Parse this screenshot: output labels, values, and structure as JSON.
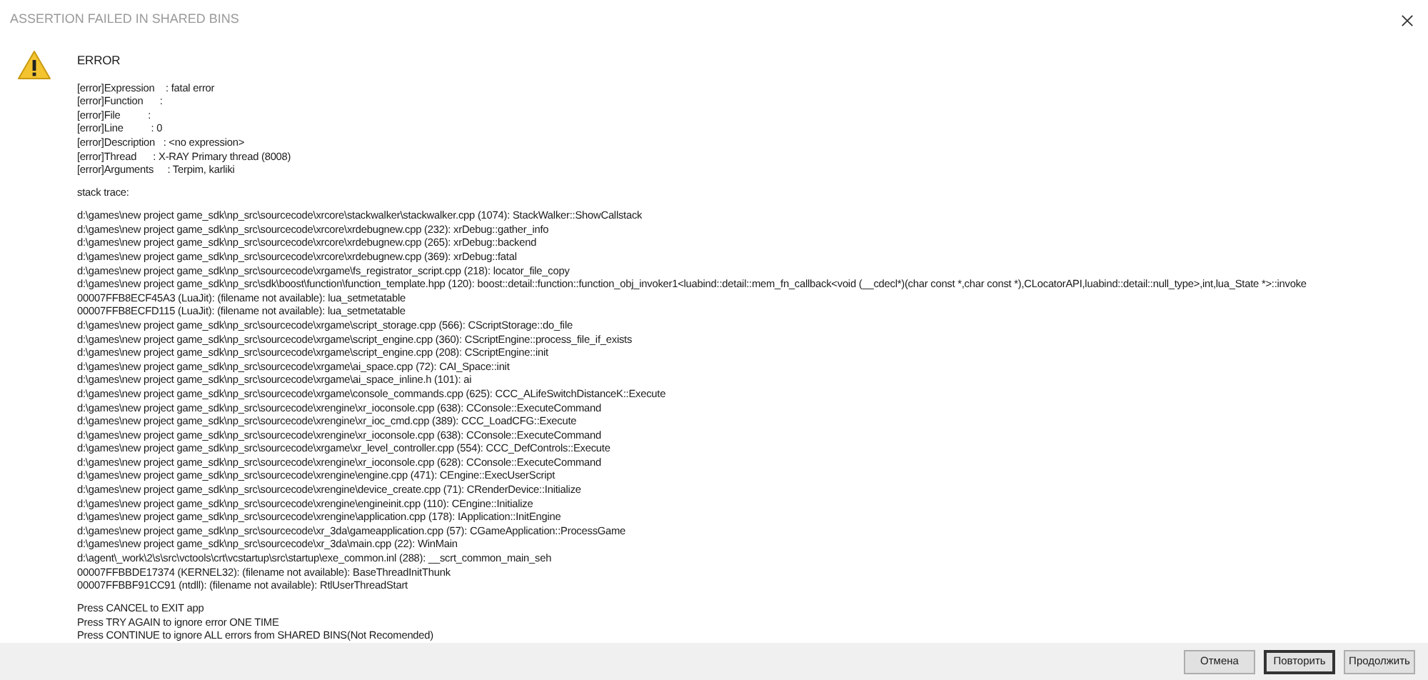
{
  "window": {
    "title": "ASSERTION FAILED IN SHARED BINS"
  },
  "heading": "ERROR",
  "details": [
    "[error]Expression    : fatal error",
    "[error]Function      :",
    "[error]File          :",
    "[error]Line          : 0",
    "[error]Description   : <no expression>",
    "[error]Thread      : X-RAY Primary thread (8008)",
    "[error]Arguments     : Terpim, karliki"
  ],
  "stack_trace_label": "stack trace:",
  "stack_trace": [
    "d:\\games\\new project game_sdk\\np_src\\sourcecode\\xrcore\\stackwalker\\stackwalker.cpp (1074): StackWalker::ShowCallstack",
    "d:\\games\\new project game_sdk\\np_src\\sourcecode\\xrcore\\xrdebugnew.cpp (232): xrDebug::gather_info",
    "d:\\games\\new project game_sdk\\np_src\\sourcecode\\xrcore\\xrdebugnew.cpp (265): xrDebug::backend",
    "d:\\games\\new project game_sdk\\np_src\\sourcecode\\xrcore\\xrdebugnew.cpp (369): xrDebug::fatal",
    "d:\\games\\new project game_sdk\\np_src\\sourcecode\\xrgame\\fs_registrator_script.cpp (218): locator_file_copy",
    "d:\\games\\new project game_sdk\\np_src\\sdk\\boost\\function\\function_template.hpp (120): boost::detail::function::function_obj_invoker1<luabind::detail::mem_fn_callback<void (__cdecl*)(char const *,char const *),CLocatorAPI,luabind::detail::null_type>,int,lua_State *>::invoke",
    "00007FFB8ECF45A3 (LuaJit): (filename not available): lua_setmetatable",
    "00007FFB8ECFD115 (LuaJit): (filename not available): lua_setmetatable",
    "d:\\games\\new project game_sdk\\np_src\\sourcecode\\xrgame\\script_storage.cpp (566): CScriptStorage::do_file",
    "d:\\games\\new project game_sdk\\np_src\\sourcecode\\xrgame\\script_engine.cpp (360): CScriptEngine::process_file_if_exists",
    "d:\\games\\new project game_sdk\\np_src\\sourcecode\\xrgame\\script_engine.cpp (208): CScriptEngine::init",
    "d:\\games\\new project game_sdk\\np_src\\sourcecode\\xrgame\\ai_space.cpp (72): CAI_Space::init",
    "d:\\games\\new project game_sdk\\np_src\\sourcecode\\xrgame\\ai_space_inline.h (101): ai",
    "d:\\games\\new project game_sdk\\np_src\\sourcecode\\xrgame\\console_commands.cpp (625): CCC_ALifeSwitchDistanceK::Execute",
    "d:\\games\\new project game_sdk\\np_src\\sourcecode\\xrengine\\xr_ioconsole.cpp (638): CConsole::ExecuteCommand",
    "d:\\games\\new project game_sdk\\np_src\\sourcecode\\xrengine\\xr_ioc_cmd.cpp (389): CCC_LoadCFG::Execute",
    "d:\\games\\new project game_sdk\\np_src\\sourcecode\\xrengine\\xr_ioconsole.cpp (638): CConsole::ExecuteCommand",
    "d:\\games\\new project game_sdk\\np_src\\sourcecode\\xrgame\\xr_level_controller.cpp (554): CCC_DefControls::Execute",
    "d:\\games\\new project game_sdk\\np_src\\sourcecode\\xrengine\\xr_ioconsole.cpp (628): CConsole::ExecuteCommand",
    "d:\\games\\new project game_sdk\\np_src\\sourcecode\\xrengine\\engine.cpp (471): CEngine::ExecUserScript",
    "d:\\games\\new project game_sdk\\np_src\\sourcecode\\xrengine\\device_create.cpp (71): CRenderDevice::Initialize",
    "d:\\games\\new project game_sdk\\np_src\\sourcecode\\xrengine\\engineinit.cpp (110): CEngine::Initialize",
    "d:\\games\\new project game_sdk\\np_src\\sourcecode\\xrengine\\application.cpp (178): IApplication::InitEngine",
    "d:\\games\\new project game_sdk\\np_src\\sourcecode\\xr_3da\\gameapplication.cpp (57): CGameApplication::ProcessGame",
    "d:\\games\\new project game_sdk\\np_src\\sourcecode\\xr_3da\\main.cpp (22): WinMain",
    "d:\\agent\\_work\\2\\s\\src\\vctools\\crt\\vcstartup\\src\\startup\\exe_common.inl (288): __scrt_common_main_seh",
    "00007FFBBDE17374 (KERNEL32): (filename not available): BaseThreadInitThunk",
    "00007FFBBF91CC91 (ntdll): (filename not available): RtlUserThreadStart"
  ],
  "instructions": [
    "Press CANCEL to EXIT app",
    "Press TRY AGAIN to ignore error ONE TIME",
    "Press CONTINUE to ignore ALL errors from SHARED BINS(Not Recomended)"
  ],
  "buttons": [
    {
      "label": "Отмена",
      "selected": false
    },
    {
      "label": "Повторить",
      "selected": true
    },
    {
      "label": "Продолжить",
      "selected": false
    }
  ]
}
